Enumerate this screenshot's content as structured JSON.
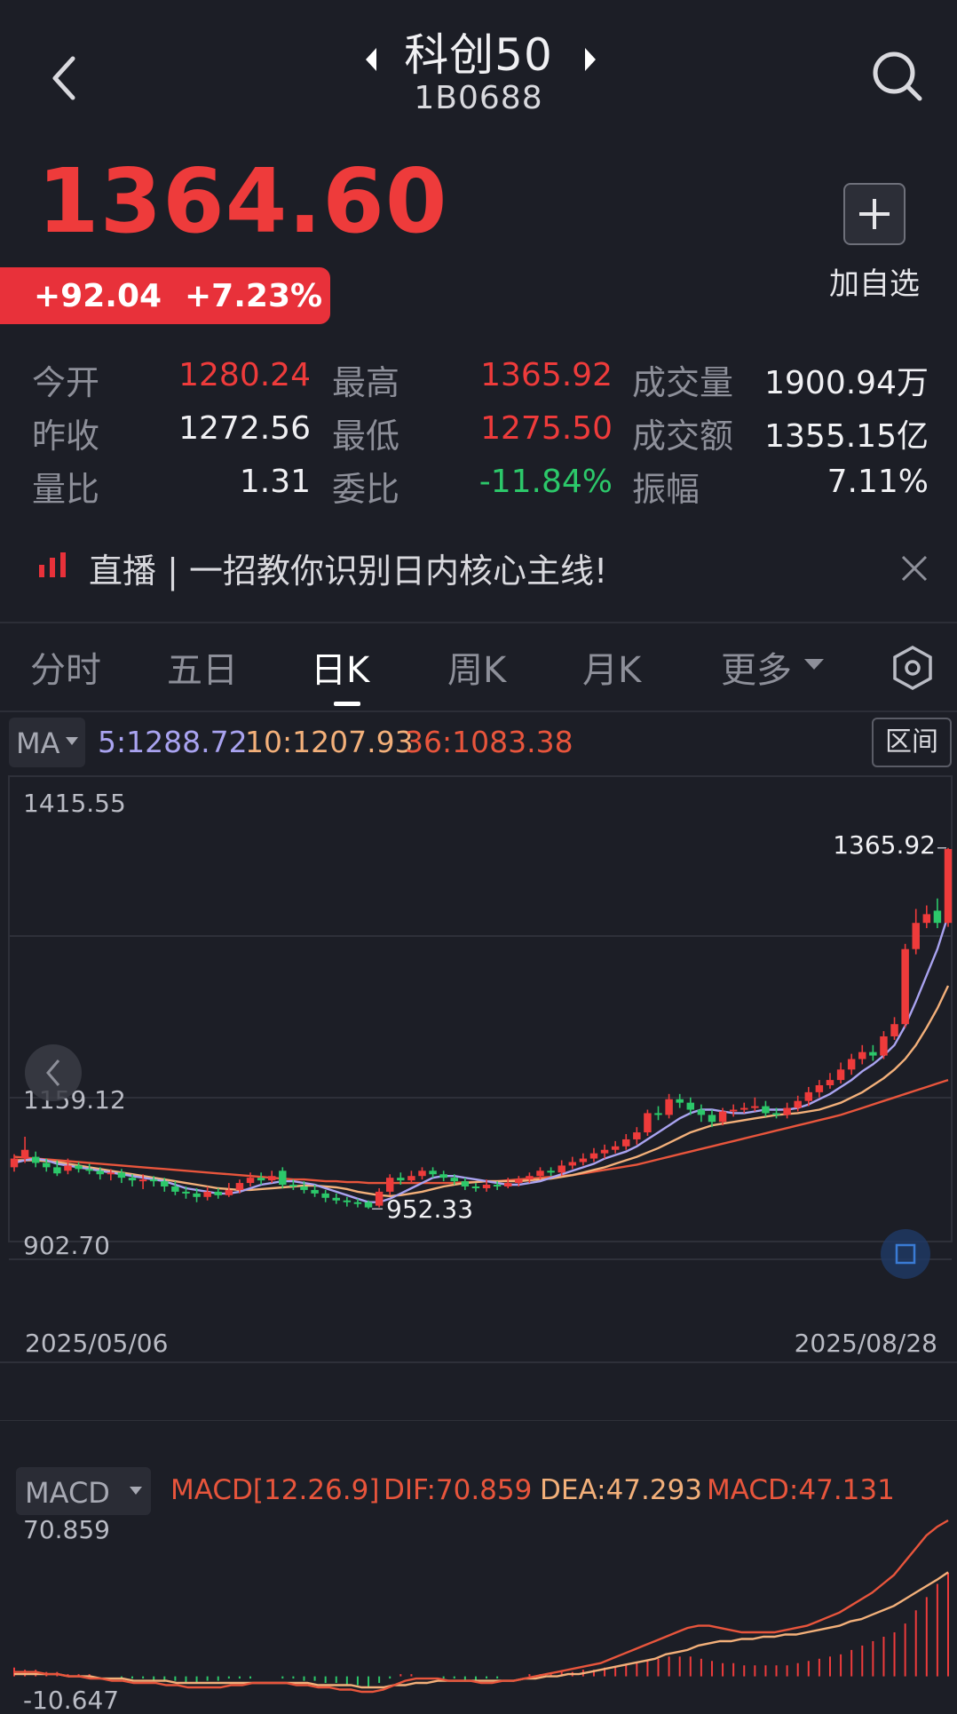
{
  "header": {
    "title": "科创50",
    "code": "1B0688"
  },
  "quote": {
    "price": "1364.60",
    "change": "+92.04",
    "change_pct": "+7.23%",
    "add_watch_label": "加自选"
  },
  "stats": [
    {
      "label": "今开",
      "value": "1280.24",
      "color": "#ee3b3b"
    },
    {
      "label": "最高",
      "value": "1365.92",
      "color": "#ee3b3b"
    },
    {
      "label": "成交量",
      "value": "1900.94万",
      "color": "#f0f0f3"
    },
    {
      "label": "昨收",
      "value": "1272.56",
      "color": "#f0f0f3"
    },
    {
      "label": "最低",
      "value": "1275.50",
      "color": "#ee3b3b"
    },
    {
      "label": "成交额",
      "value": "1355.15亿",
      "color": "#f0f0f3"
    },
    {
      "label": "量比",
      "value": "1.31",
      "color": "#f0f0f3"
    },
    {
      "label": "委比",
      "value": "-11.84%",
      "color": "#2cc86a"
    },
    {
      "label": "振幅",
      "value": "7.11%",
      "color": "#f0f0f3"
    }
  ],
  "live": {
    "text": "直播 | 一招教你识别日内核心主线!"
  },
  "tabs": [
    "分时",
    "五日",
    "日K",
    "周K",
    "月K",
    "更多"
  ],
  "active_tab": "日K",
  "ma": {
    "selector": "MA",
    "ma5": "5:1288.72",
    "ma10": "10:1207.93",
    "ma36": "36:1083.38",
    "range_button": "区间"
  },
  "colors": {
    "up": "#ee3b3b",
    "down": "#2cc86a",
    "ma5": "#a9a3f0",
    "ma10": "#f3b07a",
    "ma36": "#e8553c",
    "dif": "#e8553c",
    "dea": "#f3b07a"
  },
  "chart_data": {
    "type": "candlestick",
    "y_max_label": "1415.55",
    "y_mid_label": "1159.12",
    "y_min_label": "902.70",
    "ylim": [
      902.7,
      1415.55
    ],
    "start_date": "2025/05/06",
    "end_date": "2025/08/28",
    "high_annotation": "1365.92",
    "low_annotation": "952.33",
    "candles": [
      {
        "o": 1000,
        "c": 1010,
        "h": 1015,
        "l": 995
      },
      {
        "o": 1010,
        "c": 1020,
        "h": 1035,
        "l": 1005
      },
      {
        "o": 1012,
        "c": 1005,
        "h": 1018,
        "l": 1000
      },
      {
        "o": 1005,
        "c": 1000,
        "h": 1010,
        "l": 995
      },
      {
        "o": 1000,
        "c": 993,
        "h": 1008,
        "l": 990
      },
      {
        "o": 996,
        "c": 1002,
        "h": 1010,
        "l": 992
      },
      {
        "o": 1002,
        "c": 998,
        "h": 1006,
        "l": 994
      },
      {
        "o": 998,
        "c": 996,
        "h": 1004,
        "l": 992
      },
      {
        "o": 996,
        "c": 992,
        "h": 1000,
        "l": 986
      },
      {
        "o": 992,
        "c": 994,
        "h": 998,
        "l": 985
      },
      {
        "o": 994,
        "c": 988,
        "h": 998,
        "l": 982
      },
      {
        "o": 988,
        "c": 985,
        "h": 992,
        "l": 978
      },
      {
        "o": 985,
        "c": 986,
        "h": 992,
        "l": 975
      },
      {
        "o": 986,
        "c": 984,
        "h": 990,
        "l": 978
      },
      {
        "o": 984,
        "c": 978,
        "h": 988,
        "l": 972
      },
      {
        "o": 978,
        "c": 972,
        "h": 984,
        "l": 968
      },
      {
        "o": 972,
        "c": 970,
        "h": 978,
        "l": 964
      },
      {
        "o": 970,
        "c": 966,
        "h": 976,
        "l": 960
      },
      {
        "o": 966,
        "c": 972,
        "h": 978,
        "l": 962
      },
      {
        "o": 972,
        "c": 968,
        "h": 976,
        "l": 964
      },
      {
        "o": 968,
        "c": 974,
        "h": 982,
        "l": 966
      },
      {
        "o": 974,
        "c": 982,
        "h": 986,
        "l": 970
      },
      {
        "o": 982,
        "c": 988,
        "h": 994,
        "l": 978
      },
      {
        "o": 988,
        "c": 985,
        "h": 994,
        "l": 980
      },
      {
        "o": 985,
        "c": 990,
        "h": 996,
        "l": 982
      },
      {
        "o": 996,
        "c": 980,
        "h": 1000,
        "l": 976
      },
      {
        "o": 980,
        "c": 978,
        "h": 986,
        "l": 974
      },
      {
        "o": 978,
        "c": 974,
        "h": 984,
        "l": 970
      },
      {
        "o": 974,
        "c": 970,
        "h": 980,
        "l": 966
      },
      {
        "o": 970,
        "c": 965,
        "h": 974,
        "l": 960
      },
      {
        "o": 965,
        "c": 962,
        "h": 970,
        "l": 958
      },
      {
        "o": 962,
        "c": 960,
        "h": 966,
        "l": 955
      },
      {
        "o": 960,
        "c": 958,
        "h": 964,
        "l": 954
      },
      {
        "o": 960,
        "c": 954,
        "h": 962,
        "l": 952.33
      },
      {
        "o": 956,
        "c": 972,
        "h": 976,
        "l": 954
      },
      {
        "o": 972,
        "c": 988,
        "h": 992,
        "l": 968
      },
      {
        "o": 988,
        "c": 985,
        "h": 994,
        "l": 980
      },
      {
        "o": 985,
        "c": 990,
        "h": 996,
        "l": 982
      },
      {
        "o": 990,
        "c": 996,
        "h": 1000,
        "l": 986
      },
      {
        "o": 996,
        "c": 992,
        "h": 1000,
        "l": 988
      },
      {
        "o": 992,
        "c": 988,
        "h": 996,
        "l": 984
      },
      {
        "o": 988,
        "c": 984,
        "h": 992,
        "l": 980
      },
      {
        "o": 984,
        "c": 978,
        "h": 988,
        "l": 974
      },
      {
        "o": 978,
        "c": 976,
        "h": 982,
        "l": 972
      },
      {
        "o": 976,
        "c": 980,
        "h": 986,
        "l": 972
      },
      {
        "o": 980,
        "c": 978,
        "h": 984,
        "l": 974
      },
      {
        "o": 978,
        "c": 982,
        "h": 988,
        "l": 976
      },
      {
        "o": 982,
        "c": 986,
        "h": 990,
        "l": 978
      },
      {
        "o": 986,
        "c": 990,
        "h": 994,
        "l": 982
      },
      {
        "o": 990,
        "c": 996,
        "h": 1000,
        "l": 986
      },
      {
        "o": 996,
        "c": 994,
        "h": 1000,
        "l": 990
      },
      {
        "o": 994,
        "c": 1002,
        "h": 1008,
        "l": 990
      },
      {
        "o": 1002,
        "c": 1006,
        "h": 1012,
        "l": 998
      },
      {
        "o": 1006,
        "c": 1010,
        "h": 1016,
        "l": 1002
      },
      {
        "o": 1010,
        "c": 1016,
        "h": 1022,
        "l": 1006
      },
      {
        "o": 1016,
        "c": 1020,
        "h": 1026,
        "l": 1010
      },
      {
        "o": 1020,
        "c": 1024,
        "h": 1030,
        "l": 1016
      },
      {
        "o": 1024,
        "c": 1032,
        "h": 1038,
        "l": 1020
      },
      {
        "o": 1032,
        "c": 1040,
        "h": 1046,
        "l": 1026
      },
      {
        "o": 1040,
        "c": 1062,
        "h": 1066,
        "l": 1036
      },
      {
        "o": 1062,
        "c": 1060,
        "h": 1070,
        "l": 1054
      },
      {
        "o": 1060,
        "c": 1078,
        "h": 1084,
        "l": 1056
      },
      {
        "o": 1078,
        "c": 1074,
        "h": 1084,
        "l": 1068
      },
      {
        "o": 1074,
        "c": 1066,
        "h": 1080,
        "l": 1060
      },
      {
        "o": 1066,
        "c": 1060,
        "h": 1072,
        "l": 1052
      },
      {
        "o": 1060,
        "c": 1052,
        "h": 1066,
        "l": 1046
      },
      {
        "o": 1052,
        "c": 1064,
        "h": 1068,
        "l": 1048
      },
      {
        "o": 1064,
        "c": 1066,
        "h": 1072,
        "l": 1058
      },
      {
        "o": 1066,
        "c": 1068,
        "h": 1074,
        "l": 1062
      },
      {
        "o": 1068,
        "c": 1070,
        "h": 1080,
        "l": 1064
      },
      {
        "o": 1070,
        "c": 1062,
        "h": 1076,
        "l": 1058
      },
      {
        "o": 1062,
        "c": 1060,
        "h": 1068,
        "l": 1056
      },
      {
        "o": 1060,
        "c": 1068,
        "h": 1074,
        "l": 1056
      },
      {
        "o": 1068,
        "c": 1076,
        "h": 1082,
        "l": 1064
      },
      {
        "o": 1076,
        "c": 1086,
        "h": 1092,
        "l": 1070
      },
      {
        "o": 1086,
        "c": 1094,
        "h": 1100,
        "l": 1080
      },
      {
        "o": 1094,
        "c": 1100,
        "h": 1108,
        "l": 1090
      },
      {
        "o": 1100,
        "c": 1112,
        "h": 1120,
        "l": 1096
      },
      {
        "o": 1112,
        "c": 1124,
        "h": 1130,
        "l": 1106
      },
      {
        "o": 1124,
        "c": 1132,
        "h": 1140,
        "l": 1118
      },
      {
        "o": 1132,
        "c": 1128,
        "h": 1140,
        "l": 1122
      },
      {
        "o": 1128,
        "c": 1150,
        "h": 1156,
        "l": 1124
      },
      {
        "o": 1150,
        "c": 1164,
        "h": 1172,
        "l": 1146
      },
      {
        "o": 1164,
        "c": 1250,
        "h": 1256,
        "l": 1160
      },
      {
        "o": 1250,
        "c": 1280,
        "h": 1296,
        "l": 1244
      },
      {
        "o": 1280,
        "c": 1290,
        "h": 1300,
        "l": 1274
      },
      {
        "o": 1294,
        "c": 1280,
        "h": 1308,
        "l": 1274
      },
      {
        "o": 1280,
        "c": 1364.6,
        "h": 1365.92,
        "l": 1275.5
      }
    ],
    "ma5_points": [
      1005,
      1008,
      1010,
      1008,
      1004,
      1002,
      1000,
      998,
      996,
      994,
      992,
      990,
      988,
      986,
      984,
      980,
      976,
      974,
      972,
      970,
      970,
      972,
      976,
      980,
      982,
      984,
      984,
      982,
      980,
      976,
      972,
      968,
      964,
      960,
      960,
      964,
      970,
      976,
      982,
      988,
      990,
      990,
      988,
      986,
      984,
      982,
      980,
      980,
      982,
      984,
      988,
      992,
      996,
      1000,
      1004,
      1010,
      1014,
      1018,
      1024,
      1032,
      1040,
      1048,
      1056,
      1062,
      1066,
      1066,
      1064,
      1062,
      1062,
      1064,
      1066,
      1066,
      1066,
      1068,
      1072,
      1078,
      1084,
      1092,
      1100,
      1110,
      1118,
      1128,
      1140,
      1162,
      1190,
      1220,
      1250,
      1288.72
    ],
    "ma10_points": [
      1008,
      1008,
      1008,
      1007,
      1006,
      1004,
      1002,
      1000,
      998,
      996,
      994,
      992,
      990,
      988,
      986,
      984,
      982,
      980,
      978,
      976,
      975,
      974,
      974,
      975,
      976,
      977,
      978,
      979,
      979,
      978,
      977,
      975,
      972,
      970,
      968,
      967,
      968,
      970,
      972,
      975,
      978,
      980,
      982,
      983,
      984,
      984,
      984,
      984,
      985,
      986,
      987,
      989,
      991,
      994,
      997,
      1000,
      1004,
      1008,
      1012,
      1017,
      1022,
      1028,
      1034,
      1040,
      1044,
      1048,
      1050,
      1052,
      1054,
      1056,
      1058,
      1060,
      1061,
      1062,
      1064,
      1066,
      1070,
      1074,
      1080,
      1086,
      1094,
      1102,
      1112,
      1124,
      1140,
      1160,
      1182,
      1207.93
    ],
    "ma36_points": [
      1012,
      1011,
      1010,
      1009,
      1008,
      1007,
      1006,
      1005,
      1004,
      1003,
      1002,
      1001,
      1000,
      999,
      998,
      997,
      996,
      995,
      994,
      993,
      992,
      991,
      990,
      989,
      988,
      987,
      986,
      986,
      985,
      984,
      984,
      983,
      983,
      982,
      982,
      982,
      982,
      982,
      982,
      982,
      982,
      982,
      983,
      983,
      984,
      984,
      985,
      986,
      987,
      988,
      989,
      990,
      991,
      993,
      995,
      997,
      999,
      1001,
      1003,
      1006,
      1009,
      1012,
      1015,
      1018,
      1021,
      1024,
      1027,
      1030,
      1033,
      1036,
      1039,
      1042,
      1045,
      1048,
      1051,
      1054,
      1057,
      1060,
      1064,
      1068,
      1072,
      1076,
      1080,
      1084,
      1088,
      1092,
      1096,
      1100
    ]
  },
  "macd": {
    "selector": "MACD",
    "params": "MACD[12.26.9]",
    "dif": "DIF:70.859",
    "dea": "DEA:47.293",
    "macd": "MACD:47.131",
    "top_label": "70.859",
    "bottom_label": "-10.647",
    "ylim": [
      -10.647,
      70.859
    ],
    "hist": [
      4,
      3,
      3,
      2,
      2,
      1,
      1,
      1,
      0,
      0,
      -1,
      -1,
      -1,
      -2,
      -2,
      -2,
      -3,
      -3,
      -2,
      -2,
      -1,
      -1,
      -1,
      0,
      0,
      -1,
      -1,
      -2,
      -2,
      -3,
      -3,
      -4,
      -4,
      -5,
      -3,
      -1,
      1,
      1,
      0,
      0,
      -1,
      -1,
      -2,
      -2,
      -1,
      -1,
      0,
      0,
      1,
      1,
      1,
      2,
      2,
      3,
      3,
      4,
      4,
      5,
      6,
      7,
      8,
      9,
      9,
      9,
      8,
      7,
      6,
      6,
      5,
      5,
      5,
      5,
      5,
      6,
      7,
      8,
      9,
      10,
      12,
      14,
      16,
      18,
      20,
      24,
      30,
      36,
      42,
      47.131
    ],
    "dif_points": [
      2,
      2,
      2,
      1,
      1,
      0,
      0,
      -1,
      -1,
      -2,
      -2,
      -3,
      -3,
      -3,
      -4,
      -4,
      -5,
      -5,
      -5,
      -5,
      -4,
      -4,
      -3,
      -3,
      -3,
      -3,
      -4,
      -4,
      -5,
      -5,
      -6,
      -6,
      -7,
      -7,
      -6,
      -4,
      -2,
      -1,
      -1,
      -1,
      -2,
      -2,
      -2,
      -3,
      -3,
      -2,
      -2,
      -1,
      0,
      1,
      2,
      3,
      4,
      5,
      6,
      8,
      10,
      12,
      14,
      16,
      18,
      20,
      22,
      23,
      23,
      22,
      21,
      20,
      20,
      20,
      20,
      21,
      22,
      23,
      25,
      27,
      29,
      32,
      35,
      38,
      42,
      46,
      52,
      58,
      64,
      68,
      70.859
    ],
    "dea_points": [
      1,
      1,
      1,
      1,
      1,
      0,
      0,
      0,
      -1,
      -1,
      -1,
      -2,
      -2,
      -2,
      -2,
      -3,
      -3,
      -3,
      -3,
      -3,
      -3,
      -3,
      -3,
      -3,
      -3,
      -3,
      -3,
      -3,
      -4,
      -4,
      -4,
      -4,
      -5,
      -5,
      -5,
      -4,
      -4,
      -3,
      -3,
      -2,
      -2,
      -2,
      -2,
      -2,
      -2,
      -2,
      -2,
      -1,
      -1,
      0,
      0,
      1,
      1,
      2,
      3,
      4,
      5,
      6,
      7,
      8,
      10,
      11,
      12,
      14,
      15,
      16,
      16,
      17,
      17,
      18,
      18,
      19,
      19,
      20,
      21,
      22,
      23,
      25,
      26,
      28,
      30,
      32,
      35,
      38,
      41,
      44,
      47.293
    ]
  }
}
